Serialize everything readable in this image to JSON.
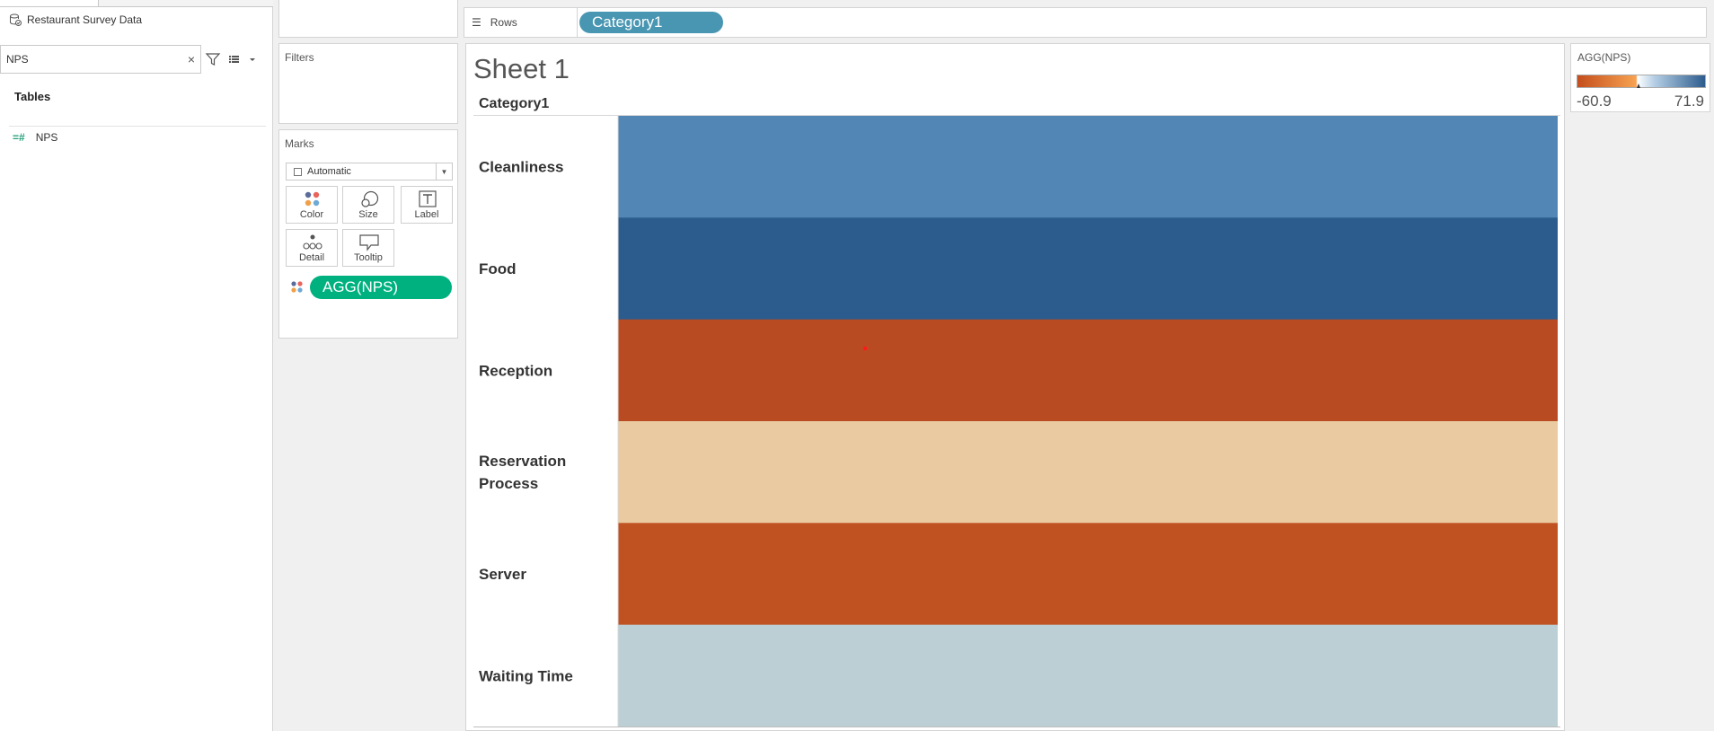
{
  "data_pane": {
    "data_source": "Restaurant Survey Data",
    "search": {
      "value": "NPS",
      "clear_icon": "×"
    },
    "tables_label": "Tables",
    "fields": [
      {
        "label": "NPS",
        "type": "measure"
      }
    ]
  },
  "filters": {
    "title": "Filters"
  },
  "marks": {
    "title": "Marks",
    "mark_type": "Automatic",
    "buttons": {
      "color": "Color",
      "size": "Size",
      "label": "Label",
      "detail": "Detail",
      "tooltip": "Tooltip"
    },
    "pill": "AGG(NPS)"
  },
  "rows_shelf": {
    "label": "Rows",
    "pill": "Category1"
  },
  "sheet": {
    "title": "Sheet 1",
    "row_header": "Category1"
  },
  "chart_data": {
    "type": "heatmap",
    "measure": "AGG(NPS)",
    "categories": [
      "Cleanliness",
      "Food",
      "Reception",
      "Reservation Process",
      "Server",
      "Waiting Time"
    ],
    "values": [
      45,
      71.9,
      -60.9,
      -18,
      -56,
      10
    ],
    "colors": [
      "#5286b4",
      "#2c5c8d",
      "#b94b22",
      "#eacaa0",
      "#c05121",
      "#bccfd4"
    ],
    "color_range": [
      -60.9,
      71.9
    ],
    "palette": [
      "#c44e1c",
      "#f7a251",
      "#ffffff",
      "#b6cfe6",
      "#2c5c8d"
    ]
  },
  "legend": {
    "title": "AGG(NPS)",
    "min": "-60.9",
    "max": "71.9"
  }
}
